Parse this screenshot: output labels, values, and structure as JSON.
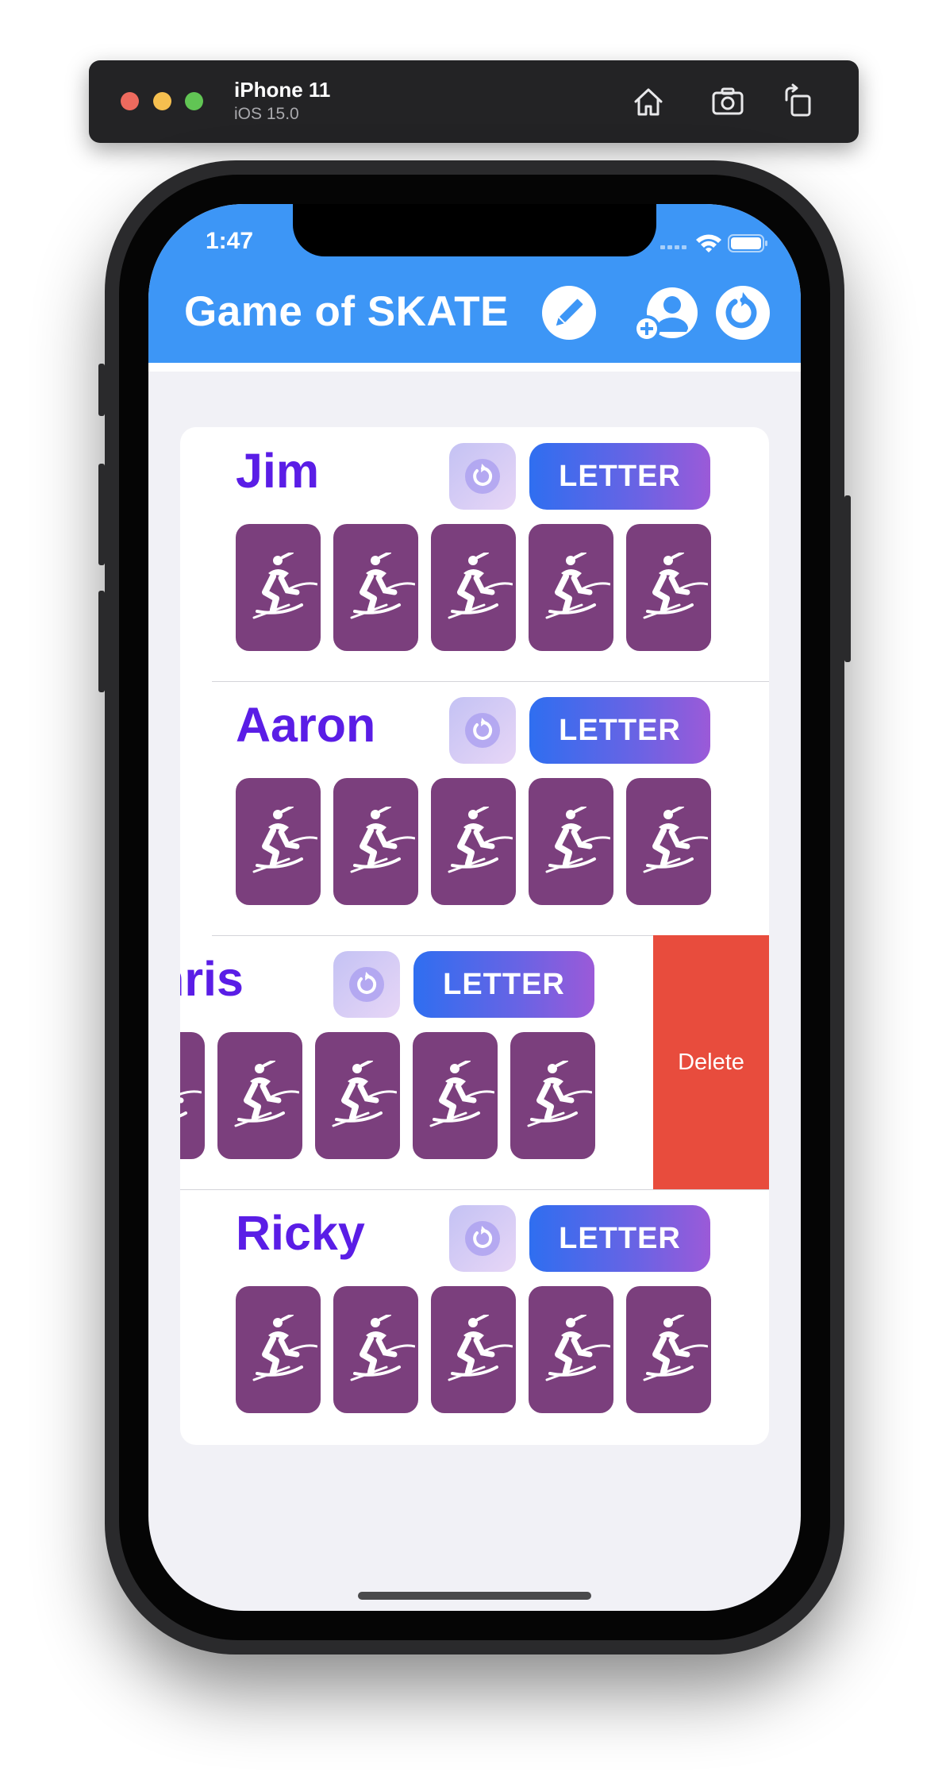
{
  "simulator": {
    "device_name": "iPhone 11",
    "os_version": "iOS 15.0",
    "icons": [
      "home-icon",
      "screenshot-icon",
      "rotate-icon"
    ]
  },
  "status_bar": {
    "time": "1:47",
    "icons": [
      "cellular-icon",
      "wifi-icon",
      "battery-icon"
    ]
  },
  "header": {
    "title": "Game of SKATE",
    "buttons": [
      "edit-icon",
      "add-player-icon",
      "reset-icon"
    ],
    "background_color": "#3d96f6"
  },
  "players": [
    {
      "name": "Jim",
      "undo_icon": "undo-icon",
      "letter_label": "LETTER",
      "tiles": [
        "skater-icon",
        "skater-icon",
        "skater-icon",
        "skater-icon",
        "skater-icon"
      ]
    },
    {
      "name": "Aaron",
      "undo_icon": "undo-icon",
      "letter_label": "LETTER",
      "tiles": [
        "skater-icon",
        "skater-icon",
        "skater-icon",
        "skater-icon",
        "skater-icon"
      ]
    },
    {
      "name": "Chris",
      "undo_icon": "undo-icon",
      "letter_label": "LETTER",
      "tiles": [
        "skater-icon",
        "skater-icon",
        "skater-icon",
        "skater-icon",
        "skater-icon"
      ],
      "swiped": true,
      "delete_label": "Delete"
    },
    {
      "name": "Ricky",
      "undo_icon": "undo-icon",
      "letter_label": "LETTER",
      "tiles": [
        "skater-icon",
        "skater-icon",
        "skater-icon",
        "skater-icon",
        "skater-icon"
      ]
    }
  ],
  "colors": {
    "name_text": "#5a1de6",
    "tile": "#7b3f7d",
    "delete": "#e84c3d",
    "letter_gradient": [
      "#2f6ef0",
      "#9b5ad8"
    ],
    "list_background": "#f1f1f6"
  }
}
